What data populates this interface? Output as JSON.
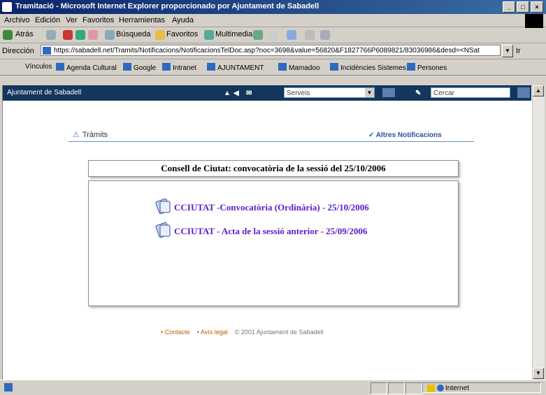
{
  "window": {
    "title": "Tramitació - Microsoft Internet Explorer proporcionado por Ajuntament de Sabadell"
  },
  "menu": [
    "Archivo",
    "Edición",
    "Ver",
    "Favoritos",
    "Herramientas",
    "Ayuda"
  ],
  "toolbar": {
    "back": "Atrás",
    "search": "Búsqueda",
    "favorites": "Favoritos",
    "multimedia": "Multimedia"
  },
  "address": {
    "label": "Dirección",
    "value": "https://sabadell.net/Tramits/Notificacions/NotificacionsTelDoc.asp?noc=3698&value=56820&F1827766P6089821/83036986&desd=<NSat",
    "go": "Ir"
  },
  "links": [
    "Vínculos",
    "Agenda Cultural",
    "Google",
    "Intranet",
    "AJUNTAMENT",
    "Mamadoo",
    "Incidències Sistemes",
    "Persones"
  ],
  "site": {
    "brand": "Ajuntament de Sabadell",
    "section_select": "Serveis",
    "search_placeholder": "Cercar"
  },
  "page": {
    "breadcrumb": "Tràmits",
    "other_notifications": "Altres Notificacions",
    "heading": "Consell de Ciutat: convocatòria de la sessió del 25/10/2006",
    "documents": [
      "CCIUTAT -Convocatòria (Ordinària) - 25/10/2006",
      "CCIUTAT - Acta de la sessió anterior - 25/09/2006"
    ]
  },
  "footer": {
    "contact": "Contacte",
    "legal": "Avís legal",
    "copyright": "© 2001 Ajuntament de Sabadell"
  },
  "status": {
    "zone": "Internet"
  }
}
